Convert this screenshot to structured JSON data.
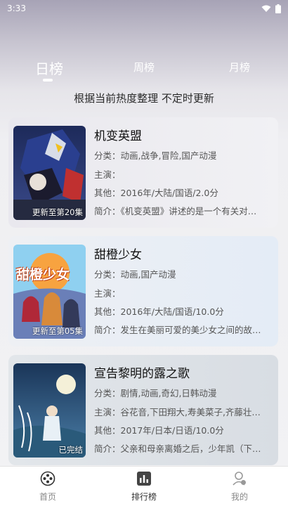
{
  "status": {
    "time": "3:33"
  },
  "tabs": [
    {
      "label": "日榜",
      "active": true
    },
    {
      "label": "周榜",
      "active": false
    },
    {
      "label": "月榜",
      "active": false
    }
  ],
  "subtitle": "根据当前热度整理 不定时更新",
  "cards": [
    {
      "title": "机变英盟",
      "badge": "更新至第20集",
      "genre": "分类：动画,战争,冒险,国产动漫",
      "cast": "主演：",
      "other": "其他：2016年/大陆/国语/2.0分",
      "intro": "简介：《机变英盟》讲述的是一个有关对…"
    },
    {
      "title": "甜橙少女",
      "cover_text": "甜橙少女",
      "badge": "更新至第05集",
      "genre": "分类：动画,国产动漫",
      "cast": "主演：",
      "other": "其他：2016年/大陆/国语/10.0分",
      "intro": "简介：发生在美丽可爱的美少女之间的故…"
    },
    {
      "title": "宣告黎明的露之歌",
      "badge": "已完结",
      "genre": "分类：剧情,动画,奇幻,日韩动漫",
      "cast": "主演：谷花音,下田翔大,寿美菜子,齐藤壮…",
      "other": "其他：2017年/日本/日语/10.0分",
      "intro": "简介：父亲和母亲离婚之后，少年凯（下…"
    }
  ],
  "nav": [
    {
      "label": "首页",
      "icon": "film-reel-icon",
      "active": false
    },
    {
      "label": "排行榜",
      "icon": "chart-icon",
      "active": true
    },
    {
      "label": "我的",
      "icon": "user-icon",
      "active": false
    }
  ]
}
